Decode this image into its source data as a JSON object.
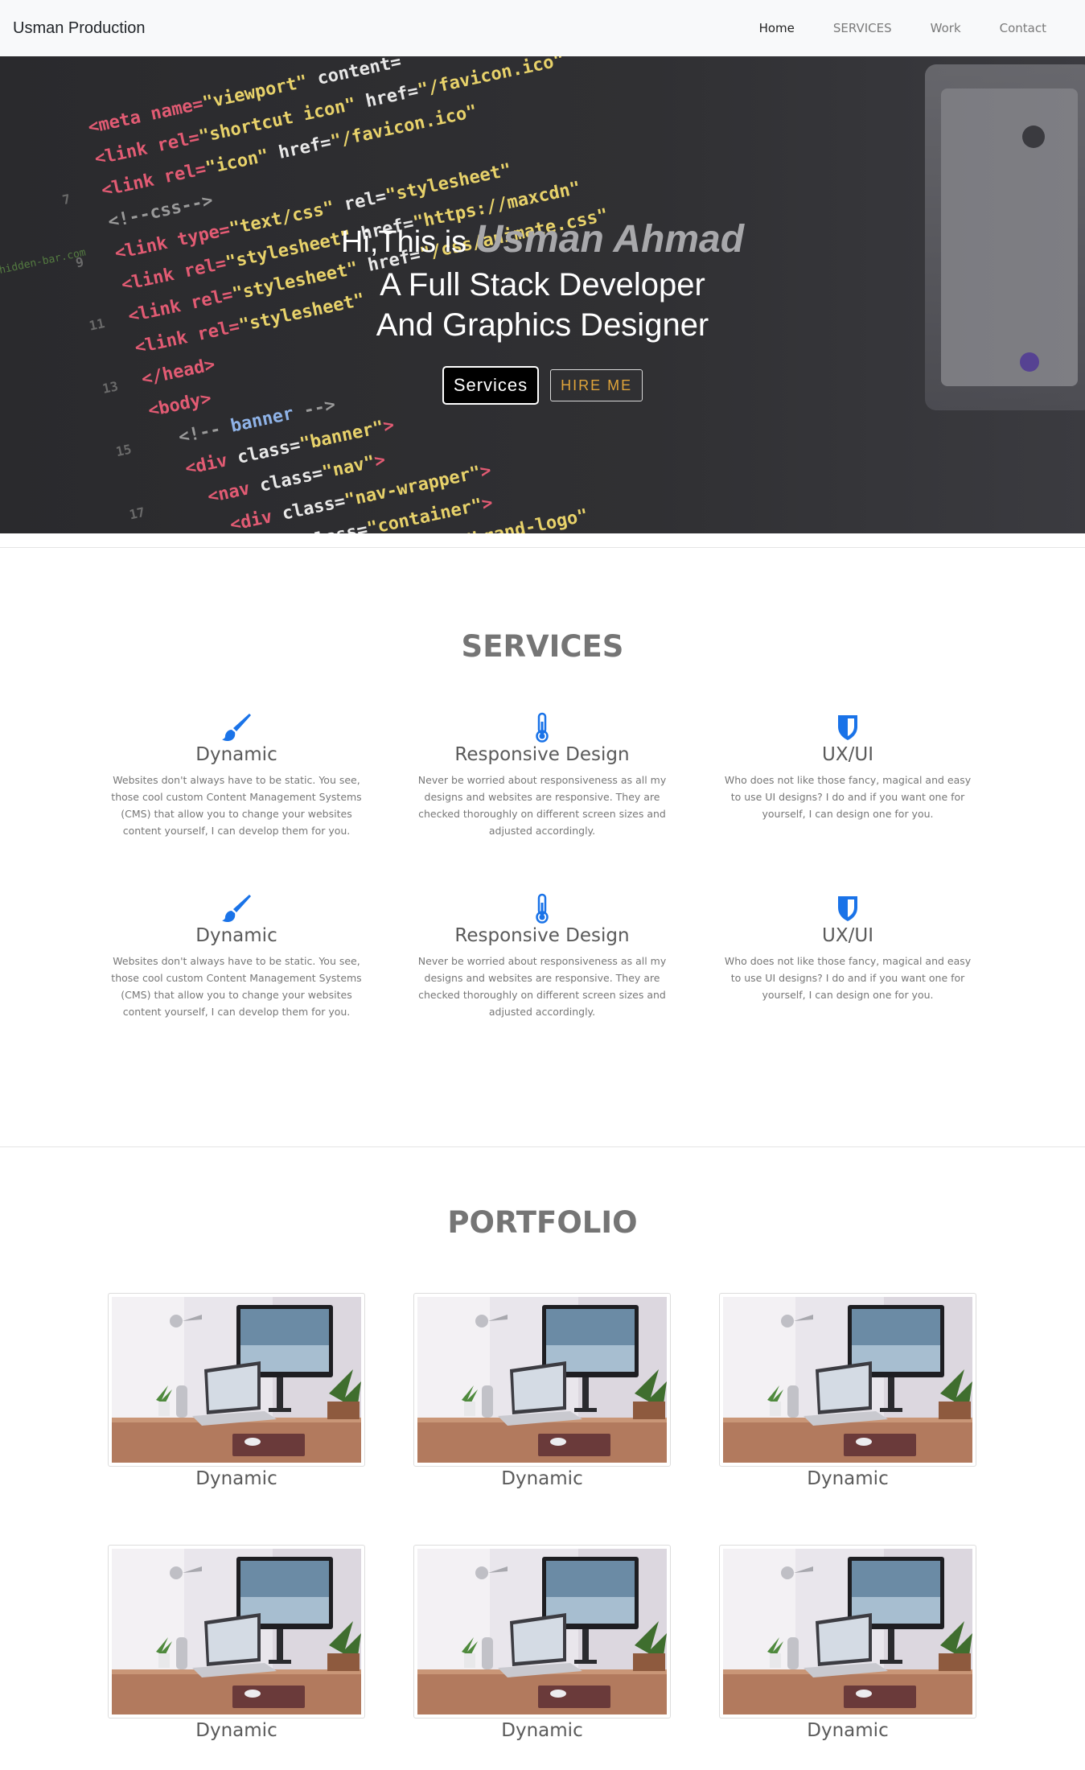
{
  "nav": {
    "brand": "Usman Production",
    "links": [
      "Home",
      "SERVICES",
      "Work",
      "Contact"
    ]
  },
  "hero": {
    "greeting": "Hi,This is ",
    "name": "Usman Ahmad",
    "line2": "A Full Stack Developer",
    "line3": "And Graphics Designer",
    "btn_services": "Services",
    "btn_hire": "HIRE ME"
  },
  "services": {
    "title": "SERVICES",
    "items": [
      {
        "icon": "paintbrush-icon",
        "title": "Dynamic",
        "text": "Websites don't always have to be static. You see, those cool custom Content Management Systems (CMS) that allow you to change your websites content yourself, I can develop them for you."
      },
      {
        "icon": "thermometer-icon",
        "title": "Responsive Design",
        "text": "Never be worried about responsiveness as all my designs and websites are responsive. They are checked thoroughly on different screen sizes and adjusted accordingly."
      },
      {
        "icon": "shield-icon",
        "title": "UX/UI",
        "text": "Who does not like those fancy, magical and easy to use UI designs? I do and if you want one for yourself, I can design one for you."
      },
      {
        "icon": "paintbrush-icon",
        "title": "Dynamic",
        "text": "Websites don't always have to be static. You see, those cool custom Content Management Systems (CMS) that allow you to change your websites content yourself, I can develop them for you."
      },
      {
        "icon": "thermometer-icon",
        "title": "Responsive Design",
        "text": "Never be worried about responsiveness as all my designs and websites are responsive. They are checked thoroughly on different screen sizes and adjusted accordingly."
      },
      {
        "icon": "shield-icon",
        "title": "UX/UI",
        "text": "Who does not like those fancy, magical and easy to use UI designs? I do and if you want one for yourself, I can design one for you."
      }
    ]
  },
  "portfolio": {
    "title": "PORTFOLIO",
    "items": [
      {
        "title": "Dynamic"
      },
      {
        "title": "Dynamic"
      },
      {
        "title": "Dynamic"
      },
      {
        "title": "Dynamic"
      },
      {
        "title": "Dynamic"
      },
      {
        "title": "Dynamic"
      }
    ]
  },
  "colors": {
    "accent": "#1a73e8",
    "hire": "#e0a43a"
  }
}
